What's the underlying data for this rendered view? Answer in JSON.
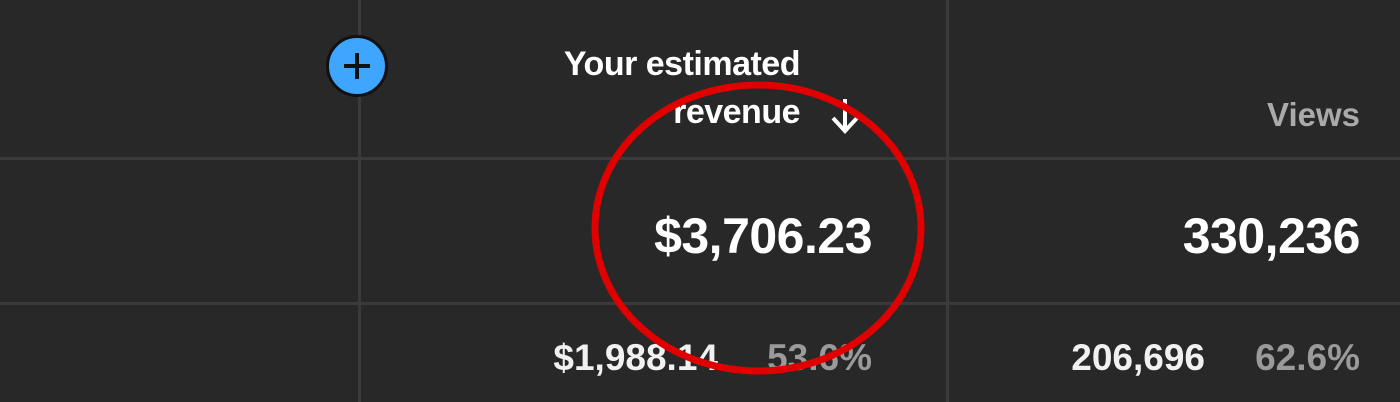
{
  "table": {
    "headers": {
      "revenue_line1": "Your estimated",
      "revenue_line2": "revenue",
      "views": "Views"
    },
    "totals": {
      "revenue": "$3,706.23",
      "views": "330,236"
    },
    "rows": [
      {
        "revenue": "$1,988.14",
        "revenue_pct": "53.6%",
        "views": "206,696",
        "views_pct": "62.6%"
      }
    ]
  },
  "icons": {
    "add": "plus-icon",
    "sort": "arrow-down-icon"
  },
  "colors": {
    "background": "#282828",
    "add_button": "#3ea6ff",
    "annotation": "#e00000"
  }
}
